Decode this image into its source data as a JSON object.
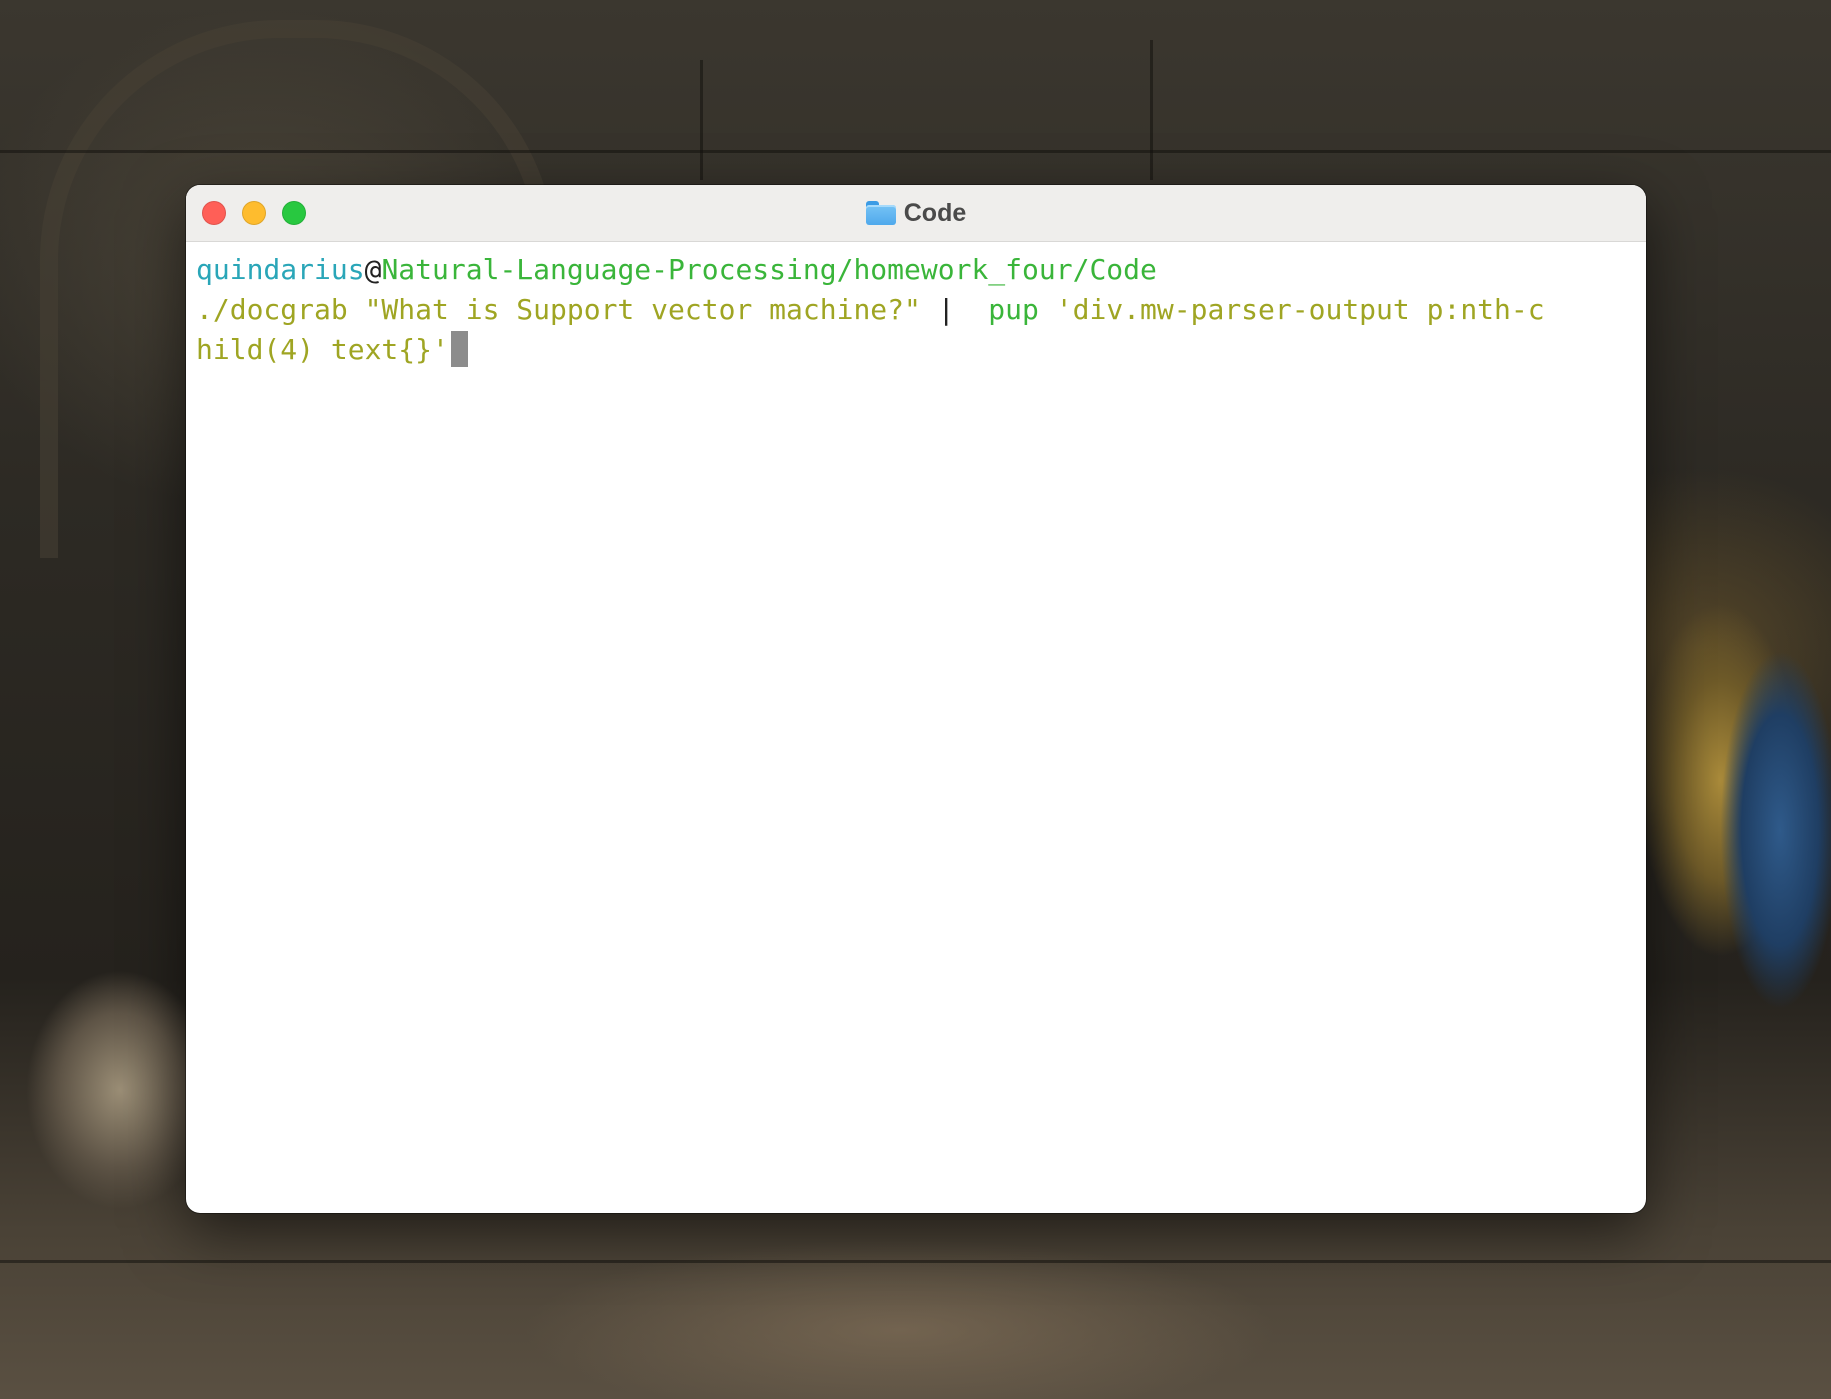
{
  "window": {
    "title": "Code",
    "title_icon": "folder-icon"
  },
  "terminal": {
    "prompt_user": "quindarius",
    "prompt_at": "@",
    "prompt_path": "Natural-Language-Processing/homework_four/Code",
    "cmd_part1": "./docgrab \"What is Support vector machine?\"",
    "cmd_pipe": " | ",
    "cmd_pup": " pup",
    "cmd_part2": " 'div.mw-parser-output p:nth-c",
    "cmd_part3": "hild(4) text{}'"
  },
  "colors": {
    "user": "#2aa6b8",
    "path": "#3ab53a",
    "command": "#9fa523",
    "close": "#ff5f57",
    "minimize": "#febc2e",
    "maximize": "#28c840"
  }
}
